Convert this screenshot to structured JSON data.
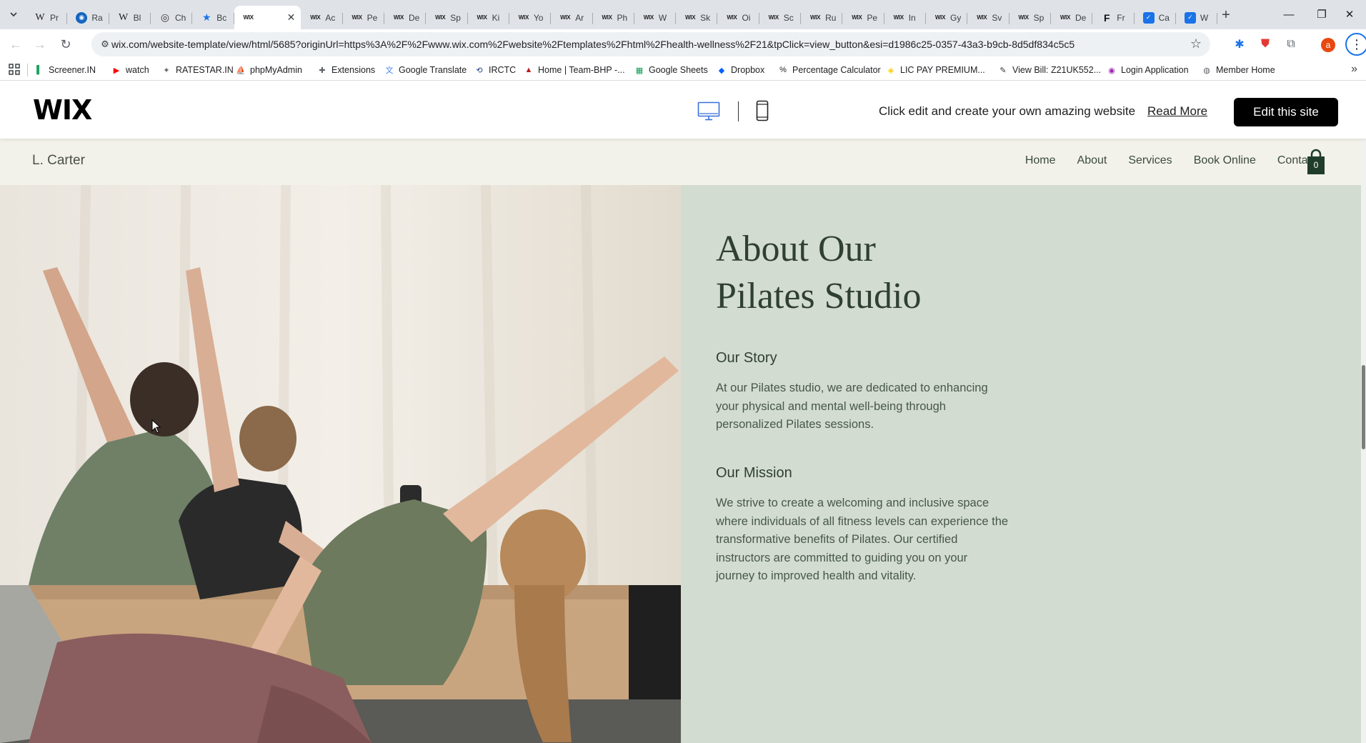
{
  "browser": {
    "tabs": [
      {
        "icon": "wiki",
        "title": "Pr"
      },
      {
        "icon": "blue",
        "title": "Ra"
      },
      {
        "icon": "wiki",
        "title": "Bl"
      },
      {
        "icon": "chat",
        "title": "Ch"
      },
      {
        "icon": "star",
        "title": "Bc"
      },
      {
        "icon": "wix",
        "title": "",
        "active": true
      },
      {
        "icon": "wix",
        "title": "Ac"
      },
      {
        "icon": "wix",
        "title": "Pe"
      },
      {
        "icon": "wix",
        "title": "De"
      },
      {
        "icon": "wix",
        "title": "Sp"
      },
      {
        "icon": "wix",
        "title": "Ki"
      },
      {
        "icon": "wix",
        "title": "Yo"
      },
      {
        "icon": "wix",
        "title": "Ar"
      },
      {
        "icon": "wix",
        "title": "Ph"
      },
      {
        "icon": "wix",
        "title": "W"
      },
      {
        "icon": "wix",
        "title": "Sk"
      },
      {
        "icon": "wix",
        "title": "Oi"
      },
      {
        "icon": "wix",
        "title": "Sc"
      },
      {
        "icon": "wix",
        "title": "Ru"
      },
      {
        "icon": "wix",
        "title": "Pe"
      },
      {
        "icon": "wix",
        "title": "In"
      },
      {
        "icon": "wix",
        "title": "Gy"
      },
      {
        "icon": "wix",
        "title": "Sv"
      },
      {
        "icon": "wix",
        "title": "Sp"
      },
      {
        "icon": "wix",
        "title": "De"
      },
      {
        "icon": "fr",
        "title": "Fr"
      },
      {
        "icon": "cal",
        "title": "Ca"
      },
      {
        "icon": "cal",
        "title": "W"
      }
    ],
    "new_tab_icon": "+",
    "url": "wix.com/website-template/view/html/5685?originUrl=https%3A%2F%2Fwww.wix.com%2Fwebsite%2Ftemplates%2Fhtml%2Fhealth-wellness%2F21&tpClick=view_button&esi=d1986c25-0357-43a3-b9cb-8d5df834c5c5",
    "profile_initial": "a",
    "bookmarks": [
      {
        "label": "Screener.IN",
        "icon": "bar-chart-icon",
        "color": "#1aa260"
      },
      {
        "label": "watch",
        "icon": "youtube-icon",
        "color": "#ff0000"
      },
      {
        "label": "RATESTAR.IN",
        "icon": "ratestar-icon",
        "color": "#666666"
      },
      {
        "label": "phpMyAdmin",
        "icon": "phpmyadmin-icon",
        "color": "#f29111"
      },
      {
        "label": "Extensions",
        "icon": "puzzle-icon",
        "color": "#5f6368"
      },
      {
        "label": "Google Translate",
        "icon": "translate-icon",
        "color": "#4285f4"
      },
      {
        "label": "IRCTC",
        "icon": "irctc-icon",
        "color": "#1f3c88"
      },
      {
        "label": "Home | Team-BHP -...",
        "icon": "teambhp-icon",
        "color": "#b71c1c"
      },
      {
        "label": "Google Sheets",
        "icon": "sheets-icon",
        "color": "#0f9d58"
      },
      {
        "label": "Dropbox",
        "icon": "dropbox-icon",
        "color": "#0061fe"
      },
      {
        "label": "Percentage Calculator",
        "icon": "percent-icon",
        "color": "#222222"
      },
      {
        "label": "LIC PAY PREMIUM...",
        "icon": "lic-icon",
        "color": "#ffcc00"
      },
      {
        "label": "View Bill: Z21UK552...",
        "icon": "bill-icon",
        "color": "#333333"
      },
      {
        "label": "Login Application",
        "icon": "login-icon",
        "color": "#9c27b0"
      },
      {
        "label": "Member Home",
        "icon": "globe-icon",
        "color": "#5f6368"
      }
    ]
  },
  "wix_bar": {
    "logo": "WIX",
    "tagline": "Click edit and create your own amazing website",
    "read_more": "Read More",
    "edit_button": "Edit this site"
  },
  "site": {
    "brand": "L. Carter",
    "nav": [
      "Home",
      "About",
      "Services",
      "Book Online",
      "Contact"
    ],
    "cart_count": "0",
    "about": {
      "title": "About Our\nPilates Studio",
      "story_heading": "Our Story",
      "story_text": "At our Pilates studio, we are dedicated to enhancing your physical and mental well-being through personalized Pilates sessions.",
      "mission_heading": "Our Mission",
      "mission_text": "We strive to create a welcoming and inclusive space where individuals of all fitness levels can experience the transformative benefits of Pilates. Our certified instructors are committed to guiding you on your journey to improved health and vitality."
    }
  },
  "colors": {
    "site_header_bg": "#f3f2ea",
    "about_panel_bg": "#d3dcd0",
    "heading_green": "#2f4033"
  }
}
